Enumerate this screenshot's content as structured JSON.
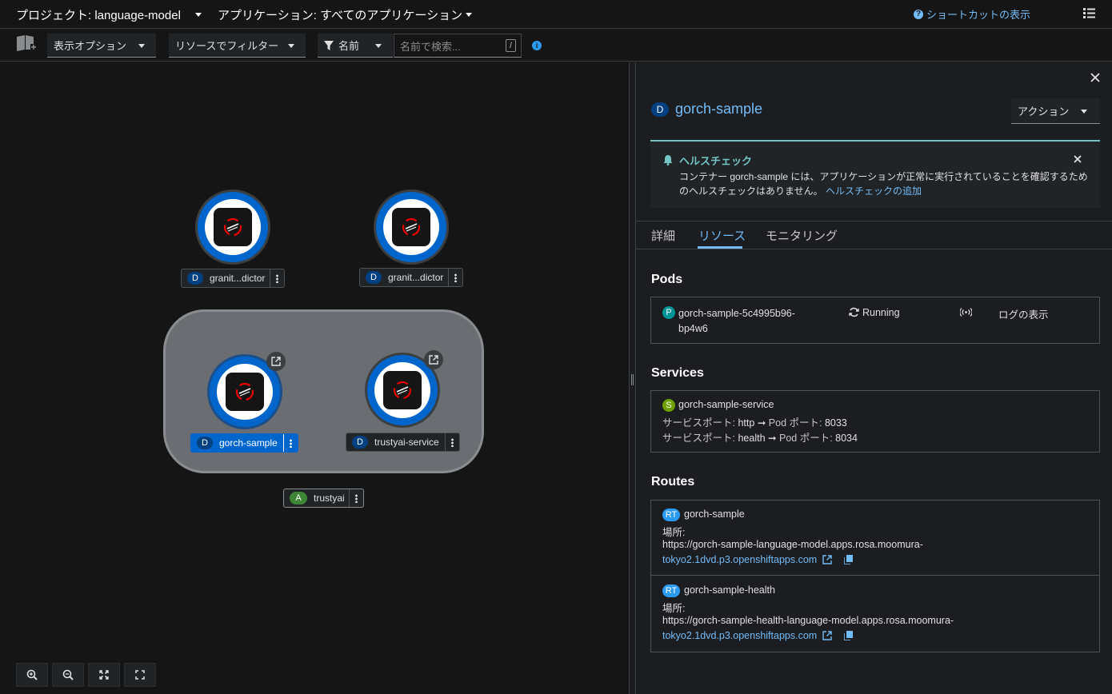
{
  "header": {
    "project_label": "プロジェクト: language-model",
    "application_label": "アプリケーション: すべてのアプリケーション",
    "shortcuts_label": "ショートカットの表示"
  },
  "toolbar": {
    "display_options": "表示オプション",
    "filter_by_resource": "リソースでフィルター",
    "name_select": "名前",
    "search_placeholder": "名前で検索...",
    "search_shortcut": "/"
  },
  "topology": {
    "nodes": [
      {
        "badge": "D",
        "label": "granit...dictor"
      },
      {
        "badge": "D",
        "label": "granit...dictor"
      },
      {
        "badge": "D",
        "label": "gorch-sample"
      },
      {
        "badge": "D",
        "label": "trustyai-service"
      }
    ],
    "application_group": {
      "badge": "A",
      "label": "trustyai"
    }
  },
  "panel": {
    "title_badge": "D",
    "title": "gorch-sample",
    "actions_label": "アクション",
    "alert": {
      "title": "ヘルスチェック",
      "body": "コンテナー gorch-sample には、アプリケーションが正常に実行されていることを確認するためのヘルスチェックはありません。",
      "link": "ヘルスチェックの追加"
    },
    "tabs": [
      "詳細",
      "リソース",
      "モニタリング"
    ],
    "pods": {
      "heading": "Pods",
      "badge": "P",
      "name_line1": "gorch-sample-5c4995b96-",
      "name_line2": "bp4w6",
      "status": "Running",
      "logs_link": "ログの表示"
    },
    "services": {
      "heading": "Services",
      "badge": "S",
      "name": "gorch-sample-service",
      "ports": [
        {
          "service_port_label": "サービスポート:",
          "service_port": "http",
          "arrow": "➞",
          "pod_port_label": "Pod ポート:",
          "pod_port": "8033"
        },
        {
          "service_port_label": "サービスポート:",
          "service_port": "health",
          "arrow": "➞",
          "pod_port_label": "Pod ポート:",
          "pod_port": "8034"
        }
      ]
    },
    "routes": {
      "heading": "Routes",
      "items": [
        {
          "badge": "RT",
          "name": "gorch-sample",
          "location_label": "場所:",
          "url_line1": "https://gorch-sample-language-model.apps.rosa.moomura-",
          "url_line2": "tokyo2.1dvd.p3.openshiftapps.com"
        },
        {
          "badge": "RT",
          "name": "gorch-sample-health",
          "location_label": "場所:",
          "url_line1": "https://gorch-sample-health-language-model.apps.rosa.moomura-",
          "url_line2": "tokyo2.1dvd.p3.openshiftapps.com"
        }
      ]
    }
  },
  "colors": {
    "accent_link": "#73bcf7",
    "selected_blue": "#0066cc",
    "deployment_badge": "#004080",
    "pod_badge": "#009596",
    "service_badge": "#6ca100",
    "route_badge": "#2b9af3",
    "app_badge": "#3e8635",
    "alert_teal": "#73c5c5"
  }
}
